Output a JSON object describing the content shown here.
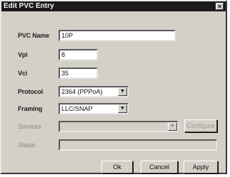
{
  "window": {
    "title": "Edit PVC Entry",
    "close_glyph": "×"
  },
  "form": {
    "pvc_name": {
      "label": "PVC Name",
      "value": "10P"
    },
    "vpi": {
      "label": "Vpi",
      "value": "8"
    },
    "vci": {
      "label": "Vci",
      "value": "35"
    },
    "protocol": {
      "label": "Protocol",
      "value": "2364 (PPPoA)"
    },
    "framing": {
      "label": "Framing",
      "value": "LLC/SNAP"
    },
    "services": {
      "label": "Services",
      "value": "",
      "button_label": "Configure"
    },
    "status": {
      "label": "Status",
      "value": ""
    }
  },
  "footer": {
    "ok_label": "Ok",
    "cancel_label": "Cancel",
    "apply_label": "Apply"
  },
  "icons": {
    "dropdown": "▼"
  }
}
